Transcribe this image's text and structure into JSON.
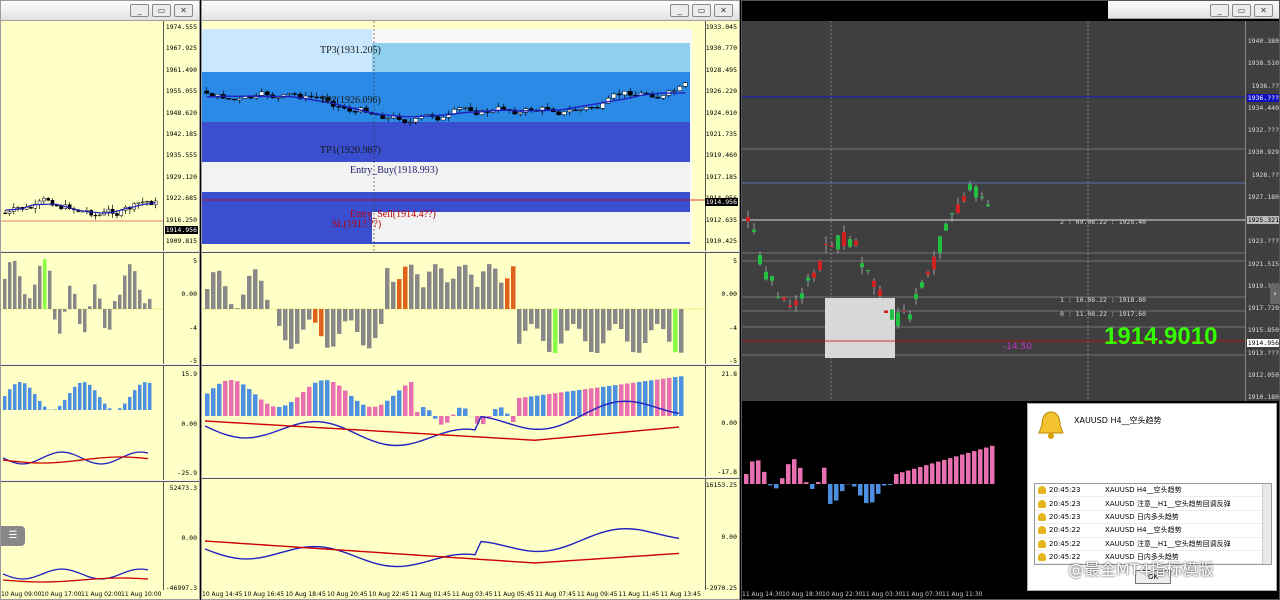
{
  "window_buttons": [
    "_",
    "▭",
    "✕"
  ],
  "left": {
    "price_ticks": [
      "1974.555",
      "1967.925",
      "1961.490",
      "1955.055",
      "1948.620",
      "1942.185",
      "1935.555",
      "1929.120",
      "1922.685",
      "1916.250",
      "1909.815"
    ],
    "price_tag": "1914.956",
    "osc1_ticks": [
      "5",
      "0.00",
      "-4",
      "-5"
    ],
    "osc2_ticks": [
      "15.9",
      "0.00",
      "-25.9"
    ],
    "osc3_ticks": [
      "52473.3",
      "0.00",
      "-46997.3"
    ],
    "x_labels": [
      "10 Aug 09:00",
      "10 Aug 17:00",
      "11 Aug 02:00",
      "11 Aug 10:00"
    ]
  },
  "middle": {
    "price_ticks": [
      "1933.045",
      "1930.770",
      "1928.495",
      "1926.220",
      "1924.010",
      "1921.735",
      "1919.460",
      "1917.185",
      "1914.956",
      "1912.635",
      "1910.425"
    ],
    "price_tag": "1914.956",
    "zones": {
      "tp3": "TP3(1931.205)",
      "tp2": "TP2(1926.096)",
      "tp1": "TP1(1920.987)",
      "entry_buy": "Entry_Buy(1918.993)",
      "entry_sell": "Entry_Sell(1914.4??)",
      "sl": "SL(191?.??)"
    },
    "osc1_ticks": [
      "5",
      "0.00",
      "-4",
      "-5"
    ],
    "osc2_ticks": [
      "21.8",
      "0.00",
      "-17.8"
    ],
    "osc3_ticks": [
      "16153.25",
      "0.00",
      "-2970.25"
    ],
    "x_labels": [
      "10 Aug 14:45",
      "10 Aug 16:45",
      "10 Aug 18:45",
      "10 Aug 20:45",
      "10 Aug 22:45",
      "11 Aug 01:45",
      "11 Aug 03:45",
      "11 Aug 05:45",
      "11 Aug 07:45",
      "11 Aug 09:45",
      "11 Aug 11:45",
      "11 Aug 13:45"
    ]
  },
  "right": {
    "price_ticks": [
      "1940.380",
      "1938.510",
      "1936.??",
      "1934.440",
      "1932.???",
      "1930.929",
      "1928.??",
      "1927.180",
      "1925.321",
      "1923.???",
      "1921.515",
      "1919.???",
      "1917.720",
      "1915.850",
      "1913.???",
      "1912.050",
      "1910.180"
    ],
    "tag_blue": "1936.???",
    "tag_light": "1925.321",
    "tag_price": "1914.956",
    "big_price": "1914.9010",
    "diff": "-14.50",
    "level_labels": [
      "2 : 09.08.22 : 1925.40",
      "1 : 10.08.22 : 1918.80",
      "0 : 11.08.22 : 1917.60"
    ],
    "x_labels": [
      "11 Aug 14:30",
      "10 Aug 18:30",
      "10 Aug 22:30",
      "11 Aug 03:30",
      "11 Aug 07:30",
      "11 Aug 11:30"
    ]
  },
  "alert": {
    "title": "XAUUSD  H4__空头趋势",
    "rows": [
      {
        "time": "20:45:23",
        "msg": "XAUUSD  H4__空头趋势"
      },
      {
        "time": "20:45:23",
        "msg": "XAUUSD  注意__H1__空头趋势回调反弹"
      },
      {
        "time": "20:45:23",
        "msg": "XAUUSD  日内多头趋势"
      },
      {
        "time": "20:45:22",
        "msg": "XAUUSD  H4__空头趋势"
      },
      {
        "time": "20:45:22",
        "msg": "XAUUSD  注意__H1__空头趋势回调反弹"
      },
      {
        "time": "20:45:22",
        "msg": "XAUUSD  日内多头趋势"
      }
    ],
    "ok_label": "OK"
  },
  "watermark": "@最全MT4指标模版",
  "colors": {
    "chart_bg": "#ffffc8",
    "right_bg": "#404040",
    "bull": "#00bb00",
    "bear": "#cc0000",
    "ma_blue": "#2020c0",
    "ma_red": "#cc0000",
    "hist_blue": "#4d8fe0",
    "hist_pink": "#e870b0",
    "big_price": "#33ff00"
  }
}
